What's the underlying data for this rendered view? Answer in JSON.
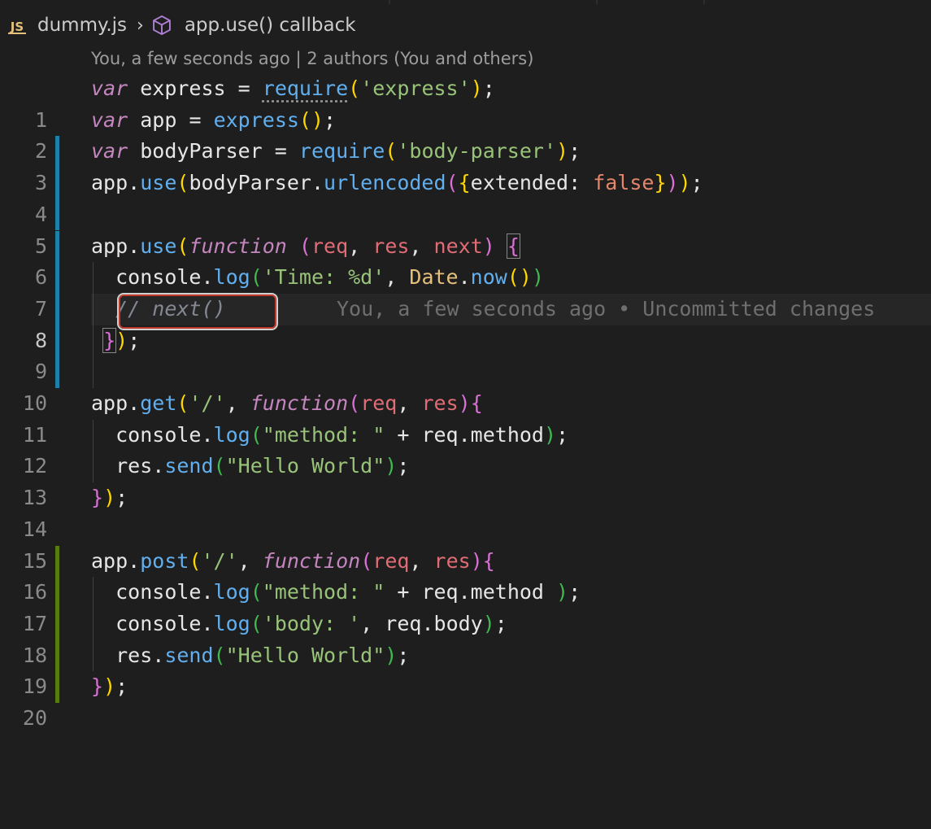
{
  "breadcrumb": {
    "file_badge": "JS",
    "file_name": "dummy.js",
    "symbol_name": "app.use() callback"
  },
  "codelens": "You, a few seconds ago | 2 authors (You and others)",
  "ghost_blame": "You, a few seconds ago • Uncommitted changes",
  "line_numbers": [
    "1",
    "2",
    "3",
    "4",
    "5",
    "6",
    "7",
    "8",
    "9",
    "10",
    "11",
    "12",
    "13",
    "14",
    "15",
    "16",
    "17",
    "18",
    "19",
    "20"
  ],
  "tokens": {
    "var": "var",
    "function": "function",
    "express": "express",
    "app": "app",
    "bodyParser": "bodyParser",
    "require": "require",
    "use": "use",
    "get": "get",
    "post": "post",
    "urlencoded": "urlencoded",
    "extended": "extended",
    "false": "false",
    "req": "req",
    "res": "res",
    "next": "next",
    "console": "console",
    "log": "log",
    "Date": "Date",
    "now": "now",
    "send": "send",
    "method": "method",
    "body": "body",
    "str_express": "'express'",
    "str_body_parser": "'body-parser'",
    "str_time": "'Time: %d'",
    "str_root": "'/'",
    "str_method": "\"method: \"",
    "str_hello": "\"Hello World\"",
    "str_body": "'body: '",
    "comment_next": "// next()"
  },
  "colors": {
    "background": "#1e1e1e",
    "gutter_modified": "#1b81a8",
    "gutter_added": "#587c0c",
    "highlight_border": "#c0392b"
  }
}
